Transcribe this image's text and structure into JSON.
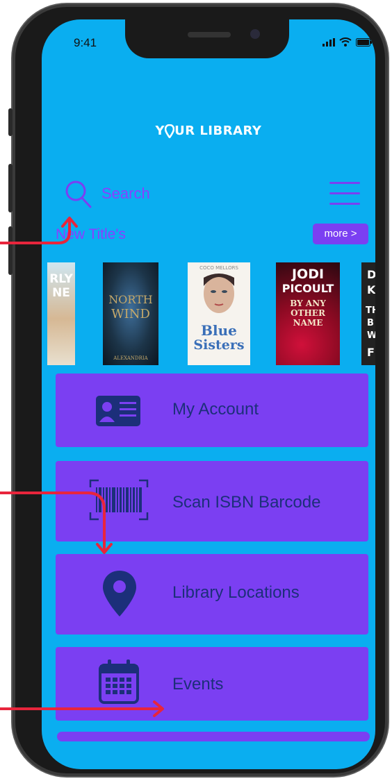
{
  "status_bar": {
    "time": "9:41"
  },
  "header": {
    "title_prefix": "Y",
    "title_suffix": "UR LIBRARY"
  },
  "search": {
    "placeholder": "Search"
  },
  "new_titles": {
    "title": "New Title's",
    "more_label": "more >",
    "books": [
      {
        "cover_text": [
          "RLY",
          "NE"
        ]
      },
      {
        "cover_text": [
          "NORTH",
          "WIND",
          "ALEXANDRIA"
        ]
      },
      {
        "cover_text": [
          "COCO MELLORS",
          "Blue",
          "Sisters"
        ]
      },
      {
        "cover_text": [
          "JODI",
          "PICOULT",
          "BY ANY",
          "OTHER",
          "NAME"
        ]
      },
      {
        "cover_text": [
          "D",
          "K",
          "TH",
          "B",
          "W",
          "F"
        ]
      }
    ]
  },
  "menu": {
    "account": "My Account",
    "scan": "Scan ISBN Barcode",
    "locations": "Library Locations",
    "events": "Events"
  },
  "colors": {
    "background": "#0aaef0",
    "card": "#7b3ff2",
    "icon": "#1c2f7a",
    "annotation_arrow": "#e8253c"
  }
}
